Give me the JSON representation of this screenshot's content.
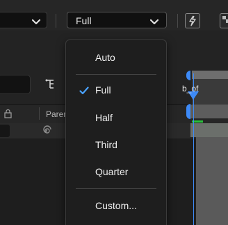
{
  "toolbar": {
    "resolution_value": "Full"
  },
  "panel": {
    "parent_column": "Parer"
  },
  "timeline": {
    "label": "b_of"
  },
  "menu": {
    "items": [
      {
        "label": "Auto",
        "checked": false
      },
      {
        "label": "Full",
        "checked": true
      },
      {
        "label": "Half",
        "checked": false
      },
      {
        "label": "Third",
        "checked": false
      },
      {
        "label": "Quarter",
        "checked": false
      },
      {
        "label": "Custom...",
        "checked": false
      }
    ]
  },
  "colors": {
    "accent": "#3d8af7",
    "menu_bg": "#1e1e1e",
    "green_marker": "#29c23c"
  },
  "icons": {
    "checkmark": "check-icon",
    "dropdown": "chevron-down-icon",
    "fast_preview": "fast-preview-icon",
    "hierarchy": "hierarchy-icon",
    "parent_spiral": "pick-whip-icon",
    "lock": "lock-icon"
  }
}
